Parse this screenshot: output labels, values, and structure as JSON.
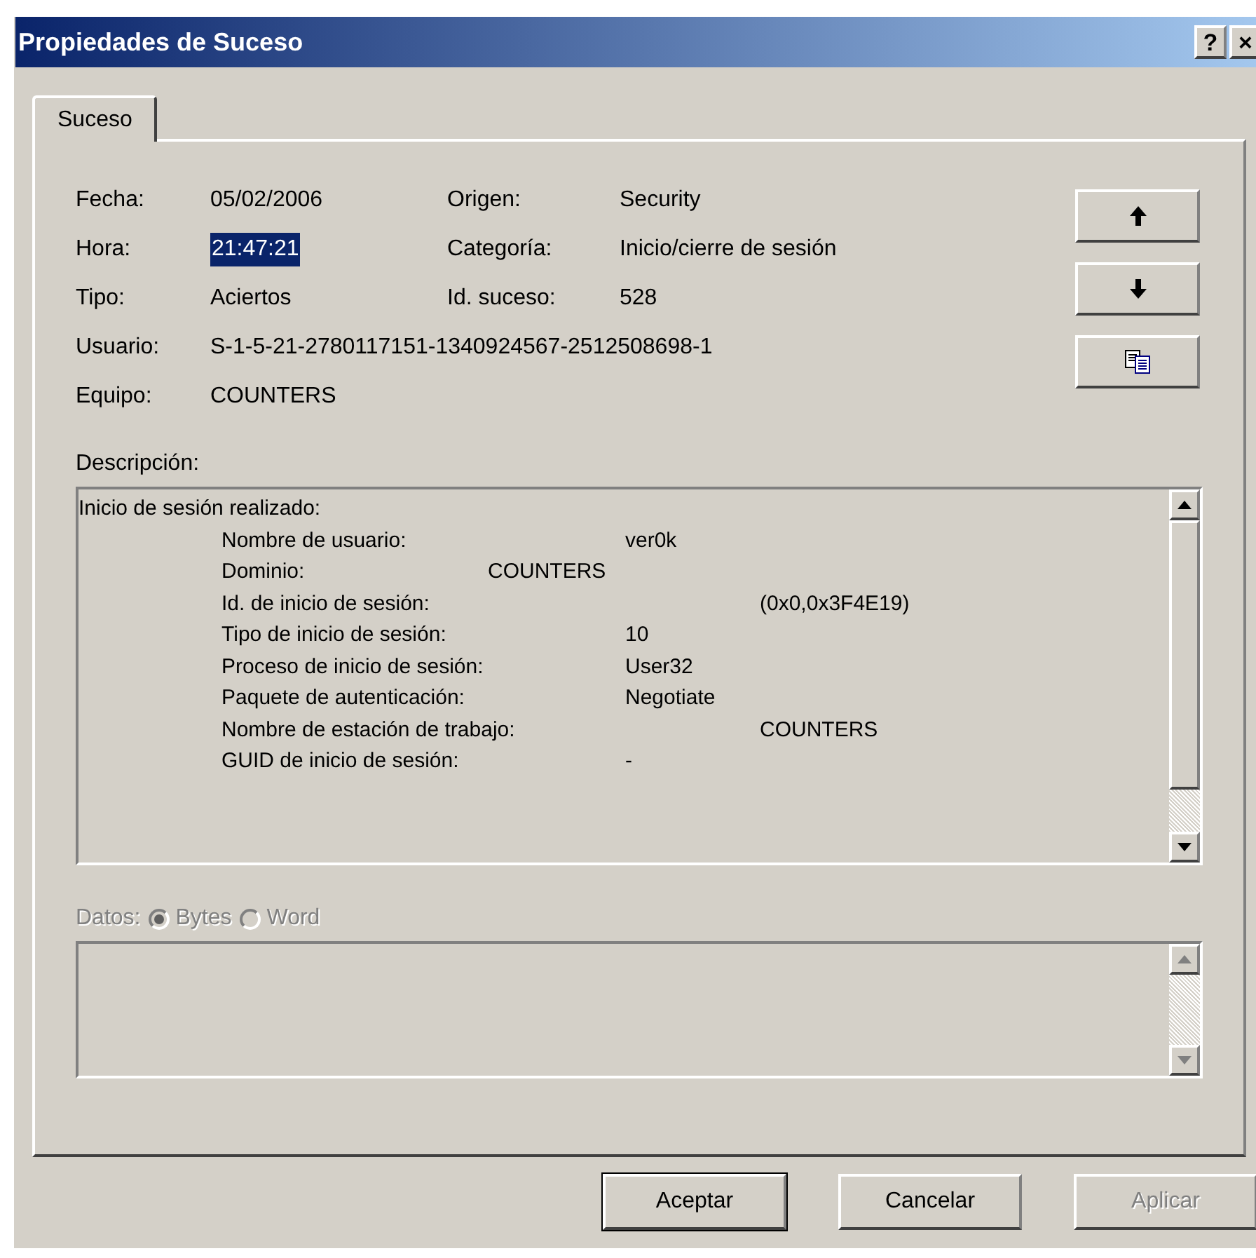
{
  "window": {
    "title": "Propiedades de Suceso",
    "title_buttons": [
      "?",
      "×"
    ]
  },
  "tabs": [
    {
      "label": "Suceso",
      "selected": true
    }
  ],
  "fields": [
    {
      "label": "Fecha:",
      "value": "05/02/2006",
      "selected": false
    },
    {
      "label": "Origen:",
      "value": "Security",
      "selected": false
    },
    {
      "label": "Hora:",
      "value": "21:47:21",
      "selected": true
    },
    {
      "label": "Categoría:",
      "value": "Inicio/cierre de sesión",
      "selected": false
    },
    {
      "label": "Tipo:",
      "value": "Aciertos",
      "selected": false
    },
    {
      "label": "Id. suceso:",
      "value": "528",
      "selected": false
    }
  ],
  "user": {
    "label": "Usuario:",
    "value": "S-1-5-21-2780117151-1340924567-2512508698-1"
  },
  "computer": {
    "label": "Equipo:",
    "value": "COUNTERS"
  },
  "side_buttons": [
    {
      "kind": "up"
    },
    {
      "kind": "down"
    },
    {
      "kind": "copy"
    }
  ],
  "description": {
    "label": "Descripción:",
    "heading": "Inicio de sesión realizado:",
    "lines": [
      {
        "label": "Nombre de usuario:",
        "value": "ver0k"
      },
      {
        "label": "Dominio:",
        "value": "COUNTERS"
      },
      {
        "label": "Id. de inicio de sesión:",
        "value": "(0x0,0x3F4E19)"
      },
      {
        "label": "Tipo de inicio de sesión:",
        "value": "10"
      },
      {
        "label": "Proceso de inicio de sesión:",
        "value": "User32"
      },
      {
        "label": "Paquete de autenticación:",
        "value": "Negotiate"
      },
      {
        "label": "Nombre de estación de trabajo:",
        "value": "COUNTERS"
      },
      {
        "label": "GUID de inicio de sesión:",
        "value": "-"
      }
    ]
  },
  "data": {
    "label": "Datos:",
    "disabled": true,
    "options": [
      {
        "label": "Bytes",
        "selected": true
      },
      {
        "label": "Word",
        "selected": false
      }
    ]
  },
  "buttons": [
    {
      "label": "Aceptar",
      "default": true,
      "disabled": false
    },
    {
      "label": "Cancelar",
      "default": false,
      "disabled": false
    },
    {
      "label": "Aplicar",
      "default": false,
      "disabled": true
    }
  ]
}
